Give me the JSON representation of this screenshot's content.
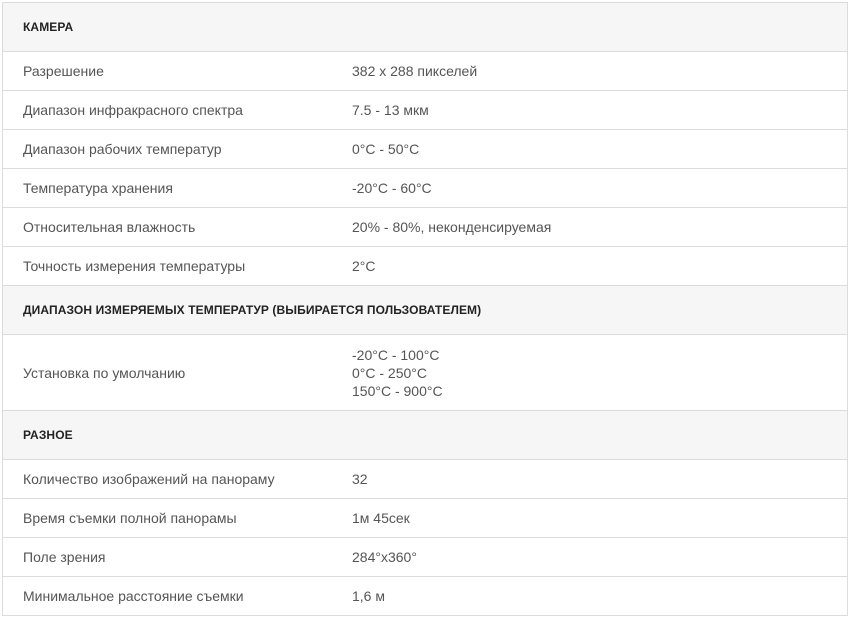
{
  "sections": [
    {
      "title": "КАМЕРА",
      "rows": [
        {
          "label": "Разрешение",
          "value": "382 x 288 пикселей"
        },
        {
          "label": "Диапазон инфракрасного спектра",
          "value": "7.5 - 13 мкм"
        },
        {
          "label": "Диапазон рабочих температур",
          "value": "0°C - 50°C"
        },
        {
          "label": "Температура хранения",
          "value": "-20°C - 60°C"
        },
        {
          "label": "Относительная влажность",
          "value": "20% - 80%, неконденсируемая"
        },
        {
          "label": "Точность измерения температуры",
          "value": "2°C"
        }
      ]
    },
    {
      "title": "ДИАПАЗОН ИЗМЕРЯЕМЫХ ТЕМПЕРАТУР (ВЫБИРАЕТСЯ ПОЛЬЗОВАТЕЛЕМ)",
      "rows": [
        {
          "label": "Установка по умолчанию",
          "values": [
            "-20°C - 100°C",
            "0°C - 250°C",
            "150°C - 900°C"
          ]
        }
      ]
    },
    {
      "title": "РАЗНОЕ",
      "rows": [
        {
          "label": "Количество изображений на панораму",
          "value": "32"
        },
        {
          "label": "Время съемки полной панорамы",
          "value": "1м 45сек"
        },
        {
          "label": "Поле зрения",
          "value": "284°x360°"
        },
        {
          "label": "Минимальное расстояние съемки",
          "value": "1,6 м"
        }
      ]
    }
  ]
}
